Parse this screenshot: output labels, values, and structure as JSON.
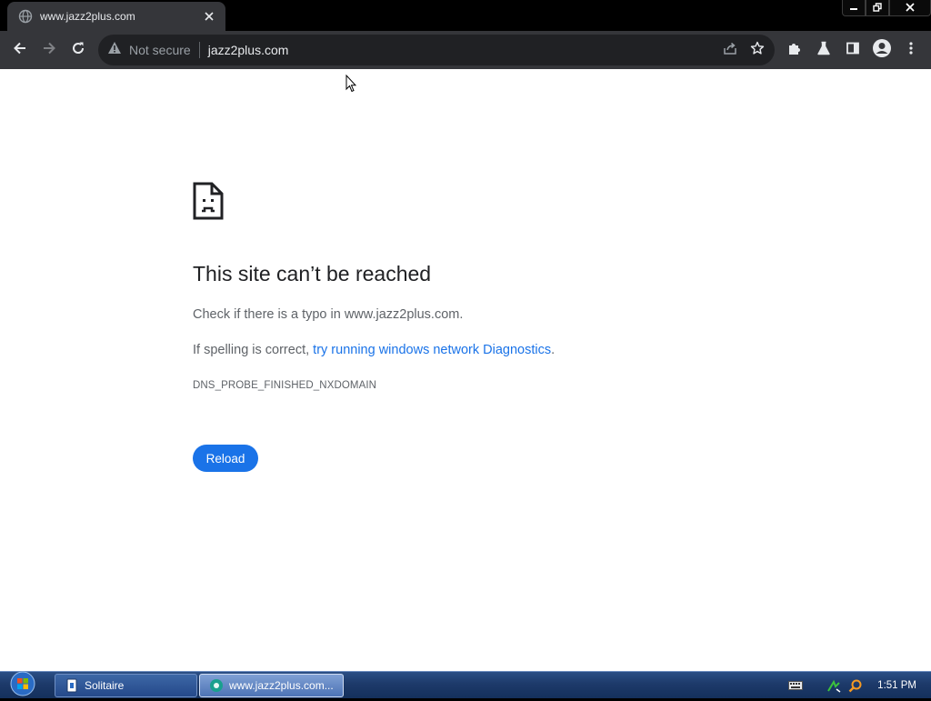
{
  "browser": {
    "tab": {
      "title": "www.jazz2plus.com",
      "favicon": "globe-icon",
      "close_icon": "close-icon"
    },
    "window_controls": [
      "minimize-icon",
      "restore-icon",
      "close-icon"
    ],
    "toolbar": {
      "back_icon": "back-arrow-icon",
      "forward_icon": "forward-arrow-icon",
      "reload_icon": "reload-icon",
      "security_label": "Not secure",
      "url": "jazz2plus.com",
      "share_icon": "share-icon",
      "bookmark_icon": "star-icon",
      "extensions_icon": "puzzle-icon",
      "labs_icon": "flask-icon",
      "sidepanel_icon": "side-panel-icon",
      "profile_icon": "profile-icon",
      "menu_icon": "kebab-menu-icon"
    }
  },
  "error_page": {
    "title": "This site can’t be reached",
    "line1": "Check if there is a typo in www.jazz2plus.com.",
    "line2_prefix": "If spelling is correct, ",
    "line2_link": "try running windows network Diagnostics",
    "line2_suffix": ".",
    "error_code": "DNS_PROBE_FINISHED_NXDOMAIN",
    "reload_label": "Reload"
  },
  "taskbar": {
    "tasks": [
      {
        "label": "Solitaire",
        "active": false
      },
      {
        "label": "www.jazz2plus.com...",
        "active": true
      }
    ],
    "clock": "1:51 PM"
  },
  "colors": {
    "accent": "#1a73e8",
    "toolbar_bg": "#35363a",
    "omnibox_bg": "#202124",
    "text_secondary": "#5f6368"
  }
}
